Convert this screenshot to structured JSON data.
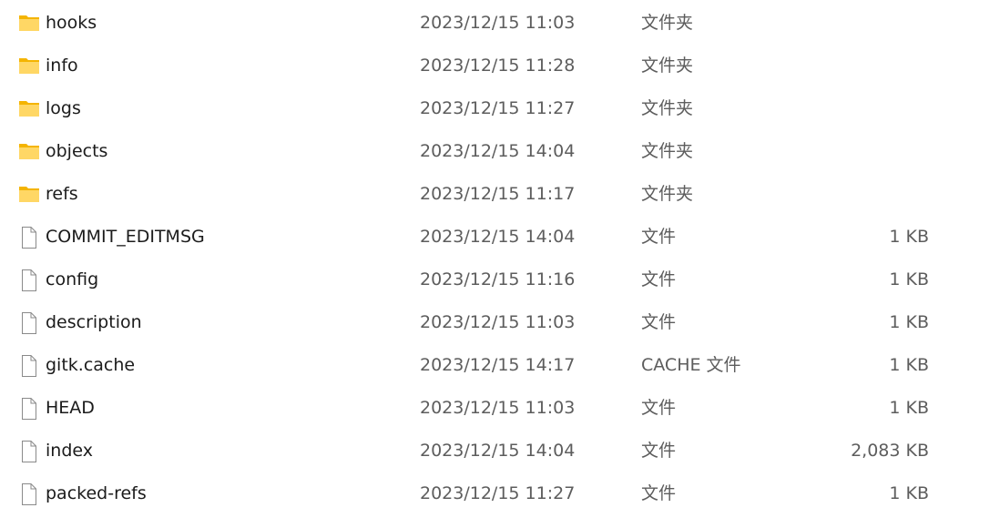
{
  "files": [
    {
      "name": "hooks",
      "date": "2023/12/15 11:03",
      "type": "文件夹",
      "size": "",
      "icon": "folder-icon"
    },
    {
      "name": "info",
      "date": "2023/12/15 11:28",
      "type": "文件夹",
      "size": "",
      "icon": "folder-icon"
    },
    {
      "name": "logs",
      "date": "2023/12/15 11:27",
      "type": "文件夹",
      "size": "",
      "icon": "folder-icon"
    },
    {
      "name": "objects",
      "date": "2023/12/15 14:04",
      "type": "文件夹",
      "size": "",
      "icon": "folder-icon"
    },
    {
      "name": "refs",
      "date": "2023/12/15 11:17",
      "type": "文件夹",
      "size": "",
      "icon": "folder-icon"
    },
    {
      "name": "COMMIT_EDITMSG",
      "date": "2023/12/15 14:04",
      "type": "文件",
      "size": "1 KB",
      "icon": "file-icon"
    },
    {
      "name": "config",
      "date": "2023/12/15 11:16",
      "type": "文件",
      "size": "1 KB",
      "icon": "file-icon"
    },
    {
      "name": "description",
      "date": "2023/12/15 11:03",
      "type": "文件",
      "size": "1 KB",
      "icon": "file-icon"
    },
    {
      "name": "gitk.cache",
      "date": "2023/12/15 14:17",
      "type": "CACHE 文件",
      "size": "1 KB",
      "icon": "file-icon"
    },
    {
      "name": "HEAD",
      "date": "2023/12/15 11:03",
      "type": "文件",
      "size": "1 KB",
      "icon": "file-icon"
    },
    {
      "name": "index",
      "date": "2023/12/15 14:04",
      "type": "文件",
      "size": "2,083 KB",
      "icon": "file-icon"
    },
    {
      "name": "packed-refs",
      "date": "2023/12/15 11:27",
      "type": "文件",
      "size": "1 KB",
      "icon": "file-icon"
    }
  ],
  "colors": {
    "folder_body": "#FFD765",
    "folder_back": "#F4B400",
    "file_outline": "#8a8a8a",
    "secondary_text": "#5d5d5d"
  }
}
